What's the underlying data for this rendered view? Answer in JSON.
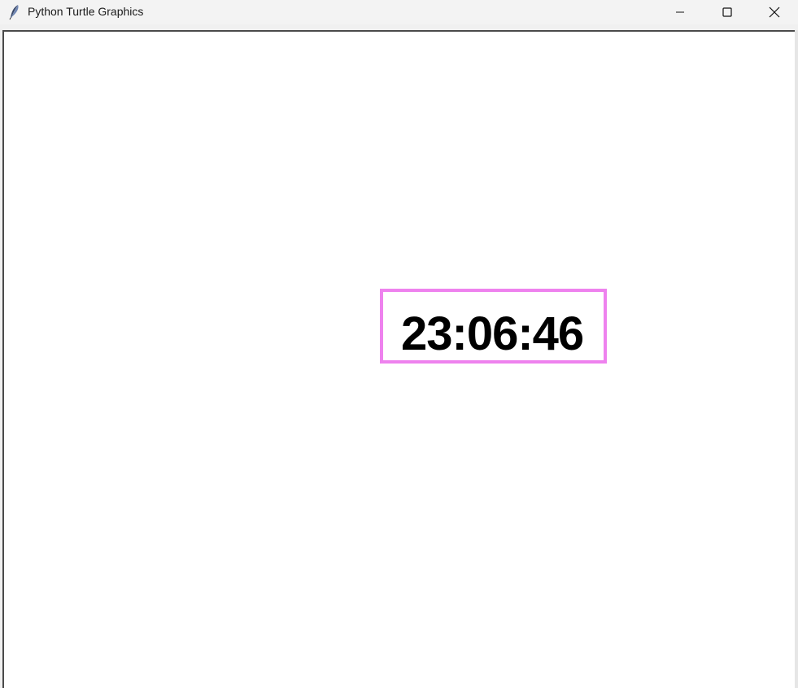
{
  "window": {
    "title": "Python Turtle Graphics",
    "controls": {
      "minimize": "minimize",
      "maximize": "maximize",
      "close": "close"
    }
  },
  "canvas": {
    "background": "#ffffff",
    "clock": {
      "time": "23:06:46",
      "border_color": "#ee82ee",
      "text_color": "#000000"
    }
  },
  "icons": {
    "app": "feather-icon",
    "minimize": "minimize-icon",
    "maximize": "maximize-icon",
    "close": "close-icon"
  }
}
